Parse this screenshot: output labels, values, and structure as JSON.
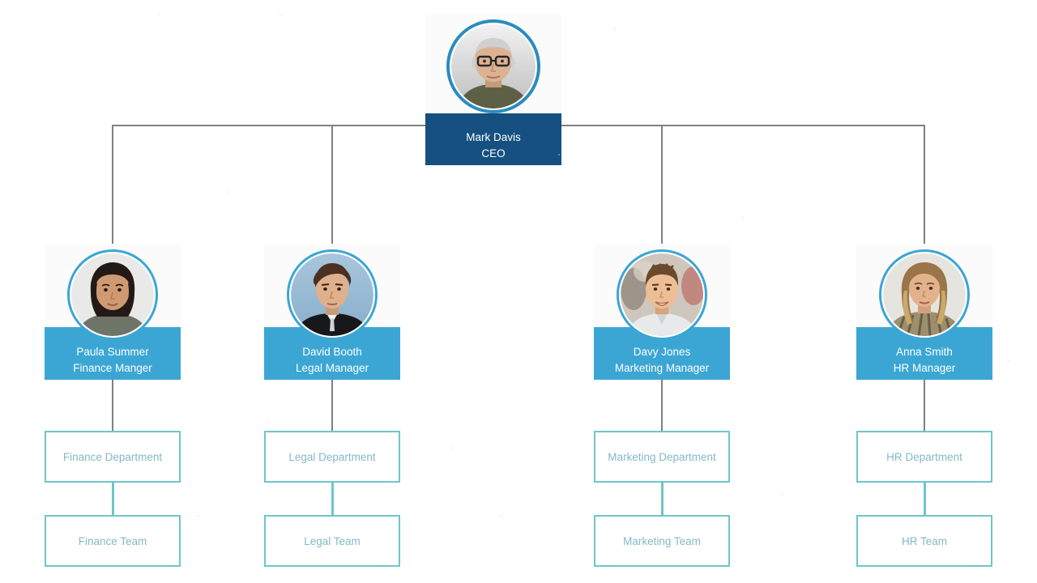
{
  "chart": {
    "type": "org-chart",
    "background_color": "#ffffff",
    "colors": {
      "ceo_bar": "#155080",
      "manager_bar": "#3ba6d4",
      "avatar_ring": "#2b8cbe",
      "manager_avatar_ring": "#3ba6d4",
      "box_border": "#6ec6ca",
      "box_text": "#83b9c6",
      "connector_gray": "#808080",
      "connector_teal": "#6ec6ca",
      "card_photo_bg": "#fbfbfb",
      "card_text": "#ffffff"
    },
    "root": {
      "id": "ceo",
      "name": "Mark Davis",
      "title": "CEO",
      "avatar": "photo-mark-davis"
    },
    "branches": [
      {
        "id": "finance",
        "manager": {
          "name": "Paula Summer",
          "title": "Finance Manger",
          "avatar": "photo-paula-summer"
        },
        "department": "Finance Department",
        "team": "Finance Team"
      },
      {
        "id": "legal",
        "manager": {
          "name": "David Booth",
          "title": "Legal Manager",
          "avatar": "photo-david-booth"
        },
        "department": "Legal Department",
        "team": "Legal Team"
      },
      {
        "id": "marketing",
        "manager": {
          "name": "Davy Jones",
          "title": "Marketing Manager",
          "avatar": "photo-davy-jones"
        },
        "department": "Marketing Department",
        "team": "Marketing Team"
      },
      {
        "id": "hr",
        "manager": {
          "name": "Anna Smith",
          "title": "HR Manager",
          "avatar": "photo-anna-smith"
        },
        "department": "HR Department",
        "team": "HR Team"
      }
    ]
  }
}
